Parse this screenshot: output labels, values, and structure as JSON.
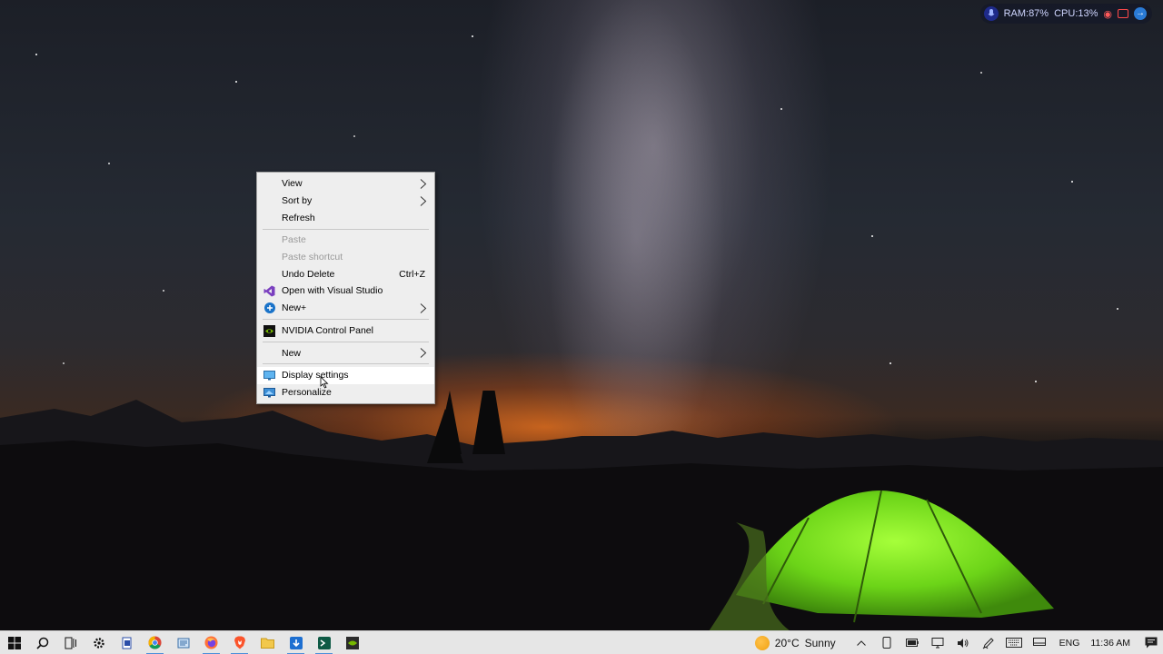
{
  "tray_widget": {
    "ram_text": "RAM:87%",
    "cpu_text": "CPU:13%"
  },
  "context_menu": {
    "items": [
      {
        "label": "View",
        "accel": "V",
        "submenu": true
      },
      {
        "label": "Sort by",
        "accel": "o",
        "submenu": true
      },
      {
        "label": "Refresh",
        "accel": "e"
      },
      {
        "label": "Paste",
        "accel": "P",
        "disabled": true
      },
      {
        "label": "Paste shortcut",
        "accel": "S",
        "disabled": true
      },
      {
        "label": "Undo Delete",
        "accel": "U",
        "shortcut": "Ctrl+Z"
      },
      {
        "label": "Open with Visual Studio",
        "icon": "visual-studio-icon"
      },
      {
        "label": "New+",
        "icon": "plus-circle-icon",
        "submenu": true
      },
      {
        "label": "NVIDIA Control Panel",
        "icon": "nvidia-icon"
      },
      {
        "label": "New",
        "accel": "w",
        "submenu": true
      },
      {
        "label": "Display settings",
        "icon": "display-settings-icon",
        "highlighted": true
      },
      {
        "label": "Personalize",
        "icon": "personalize-icon"
      }
    ]
  },
  "taskbar": {
    "apps": [
      "windows-start-icon",
      "search-icon",
      "task-view-icon",
      "settings-gear-icon",
      "document-app-icon",
      "chrome-icon",
      "file-app-icon",
      "firefox-icon",
      "brave-icon",
      "file-explorer-icon",
      "download-app-icon",
      "terminal-app-icon",
      "nvidia-app-icon"
    ],
    "weather_temp": "20°C",
    "weather_desc": "Sunny",
    "language": "ENG",
    "time": "11:36 AM"
  },
  "colors": {
    "menu_bg": "#eeeeee",
    "menu_highlight": "#ffffff",
    "taskbar_bg": "#e6e6e6",
    "accent": "#4a8fd9",
    "tent_green": "#7be01e"
  }
}
